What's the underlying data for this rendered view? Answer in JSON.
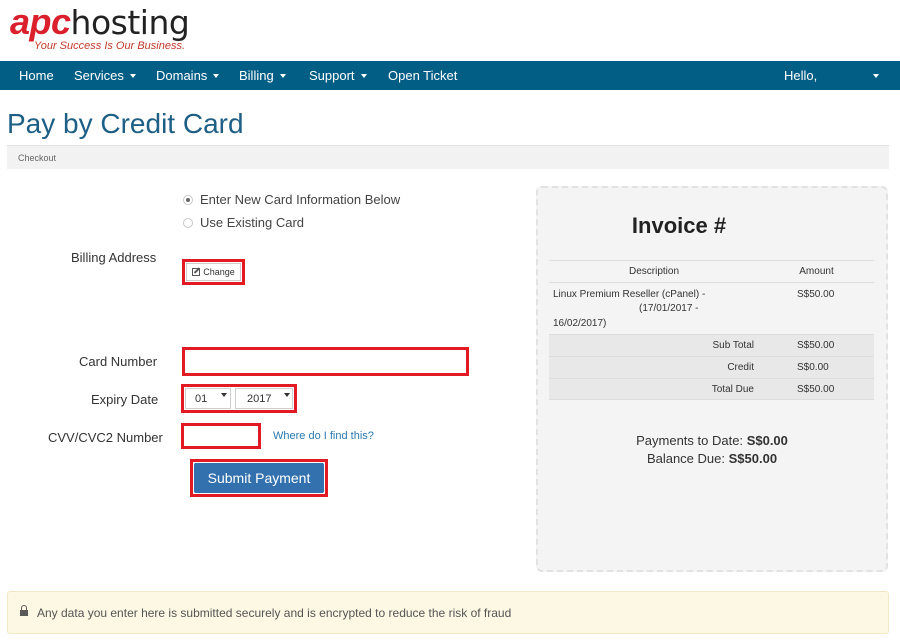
{
  "logo": {
    "brand_a": "apc",
    "brand_b": "hosting",
    "tagline": "Your Success Is Our Business."
  },
  "nav": {
    "items": [
      {
        "label": "Home",
        "dropdown": false
      },
      {
        "label": "Services",
        "dropdown": true
      },
      {
        "label": "Domains",
        "dropdown": true
      },
      {
        "label": "Billing",
        "dropdown": true
      },
      {
        "label": "Support",
        "dropdown": true
      },
      {
        "label": "Open Ticket",
        "dropdown": false
      }
    ],
    "user_greeting": "Hello,"
  },
  "page": {
    "title": "Pay by Credit Card",
    "breadcrumb": "Checkout"
  },
  "form": {
    "card_options": [
      {
        "label": "Enter New Card Information Below",
        "selected": true
      },
      {
        "label": "Use Existing Card",
        "selected": false
      }
    ],
    "billing_address_label": "Billing Address",
    "change_label": "Change",
    "card_number_label": "Card Number",
    "card_number_value": "",
    "expiry_label": "Expiry Date",
    "expiry_month": "01",
    "expiry_year": "2017",
    "cvv_label": "CVV/CVC2 Number",
    "cvv_value": "",
    "cvv_help_link": "Where do I find this?",
    "submit_label": "Submit Payment"
  },
  "invoice": {
    "title": "Invoice #",
    "col_description": "Description",
    "col_amount": "Amount",
    "item": {
      "line1": "Linux Premium Reseller (cPanel) -",
      "line2": "(17/01/2017 -",
      "line3": "16/02/2017)",
      "amount": "S$50.00"
    },
    "subtotal_label": "Sub Total",
    "subtotal_value": "S$50.00",
    "credit_label": "Credit",
    "credit_value": "S$0.00",
    "total_label": "Total Due",
    "total_value": "S$50.00",
    "payments_label": "Payments to Date:",
    "payments_value": "S$0.00",
    "balance_label": "Balance Due:",
    "balance_value": "S$50.00"
  },
  "alert": {
    "text": "Any data you enter here is submitted securely and is encrypted to reduce the risk of fraud"
  },
  "colors": {
    "navbar": "#025e85",
    "title": "#1d5f85",
    "highlight": "#e21a23",
    "button": "#3271ad",
    "brand_red": "#d9202c"
  }
}
